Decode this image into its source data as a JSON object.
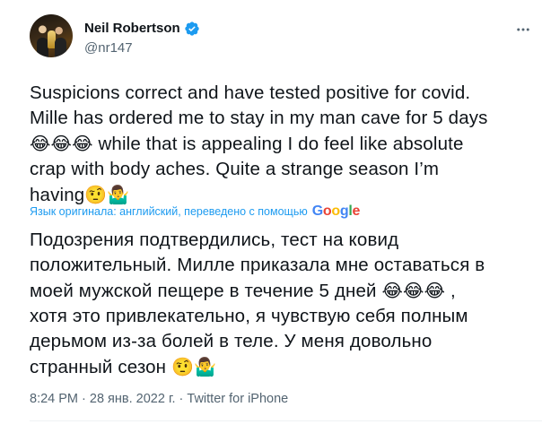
{
  "author": {
    "name": "Neil Robertson",
    "handle": "@nr147"
  },
  "tweet": {
    "original_lines": [
      "Suspicions correct and have tested positive for covid.",
      "Mille has ordered me to stay in my man cave for 5 days",
      "while that is appealing I do feel like absolute",
      "crap with body aches. Quite a strange season I’m",
      "having"
    ],
    "emoji_crying_laughing": "😂",
    "emoji_raised_eyebrow": "🤨",
    "emoji_man_shrugging": "🤷‍♂️",
    "translation_note": "Язык оригинала: английский, переведено с помощью",
    "translation_provider": "Google",
    "translated_lines": [
      "Подозрения подтвердились, тест на ковид",
      "положительный. Милле приказала мне оставаться в",
      "моей мужской пещере в течение 5 дней",
      ",",
      "хотя это привлекательно, я чувствую себя полным",
      "дерьмом из-за болей в теле. У меня довольно",
      "странный сезон"
    ]
  },
  "meta": {
    "time": "8:24 PM",
    "separator": " · ",
    "date": "28 янв. 2022 г.",
    "source": "Twitter for iPhone"
  },
  "colors": {
    "link": "#1d9bf0",
    "secondary": "#536471",
    "google_blue": "#4285F4",
    "google_red": "#EA4335",
    "google_yellow": "#FBBC05",
    "google_green": "#34A853"
  }
}
